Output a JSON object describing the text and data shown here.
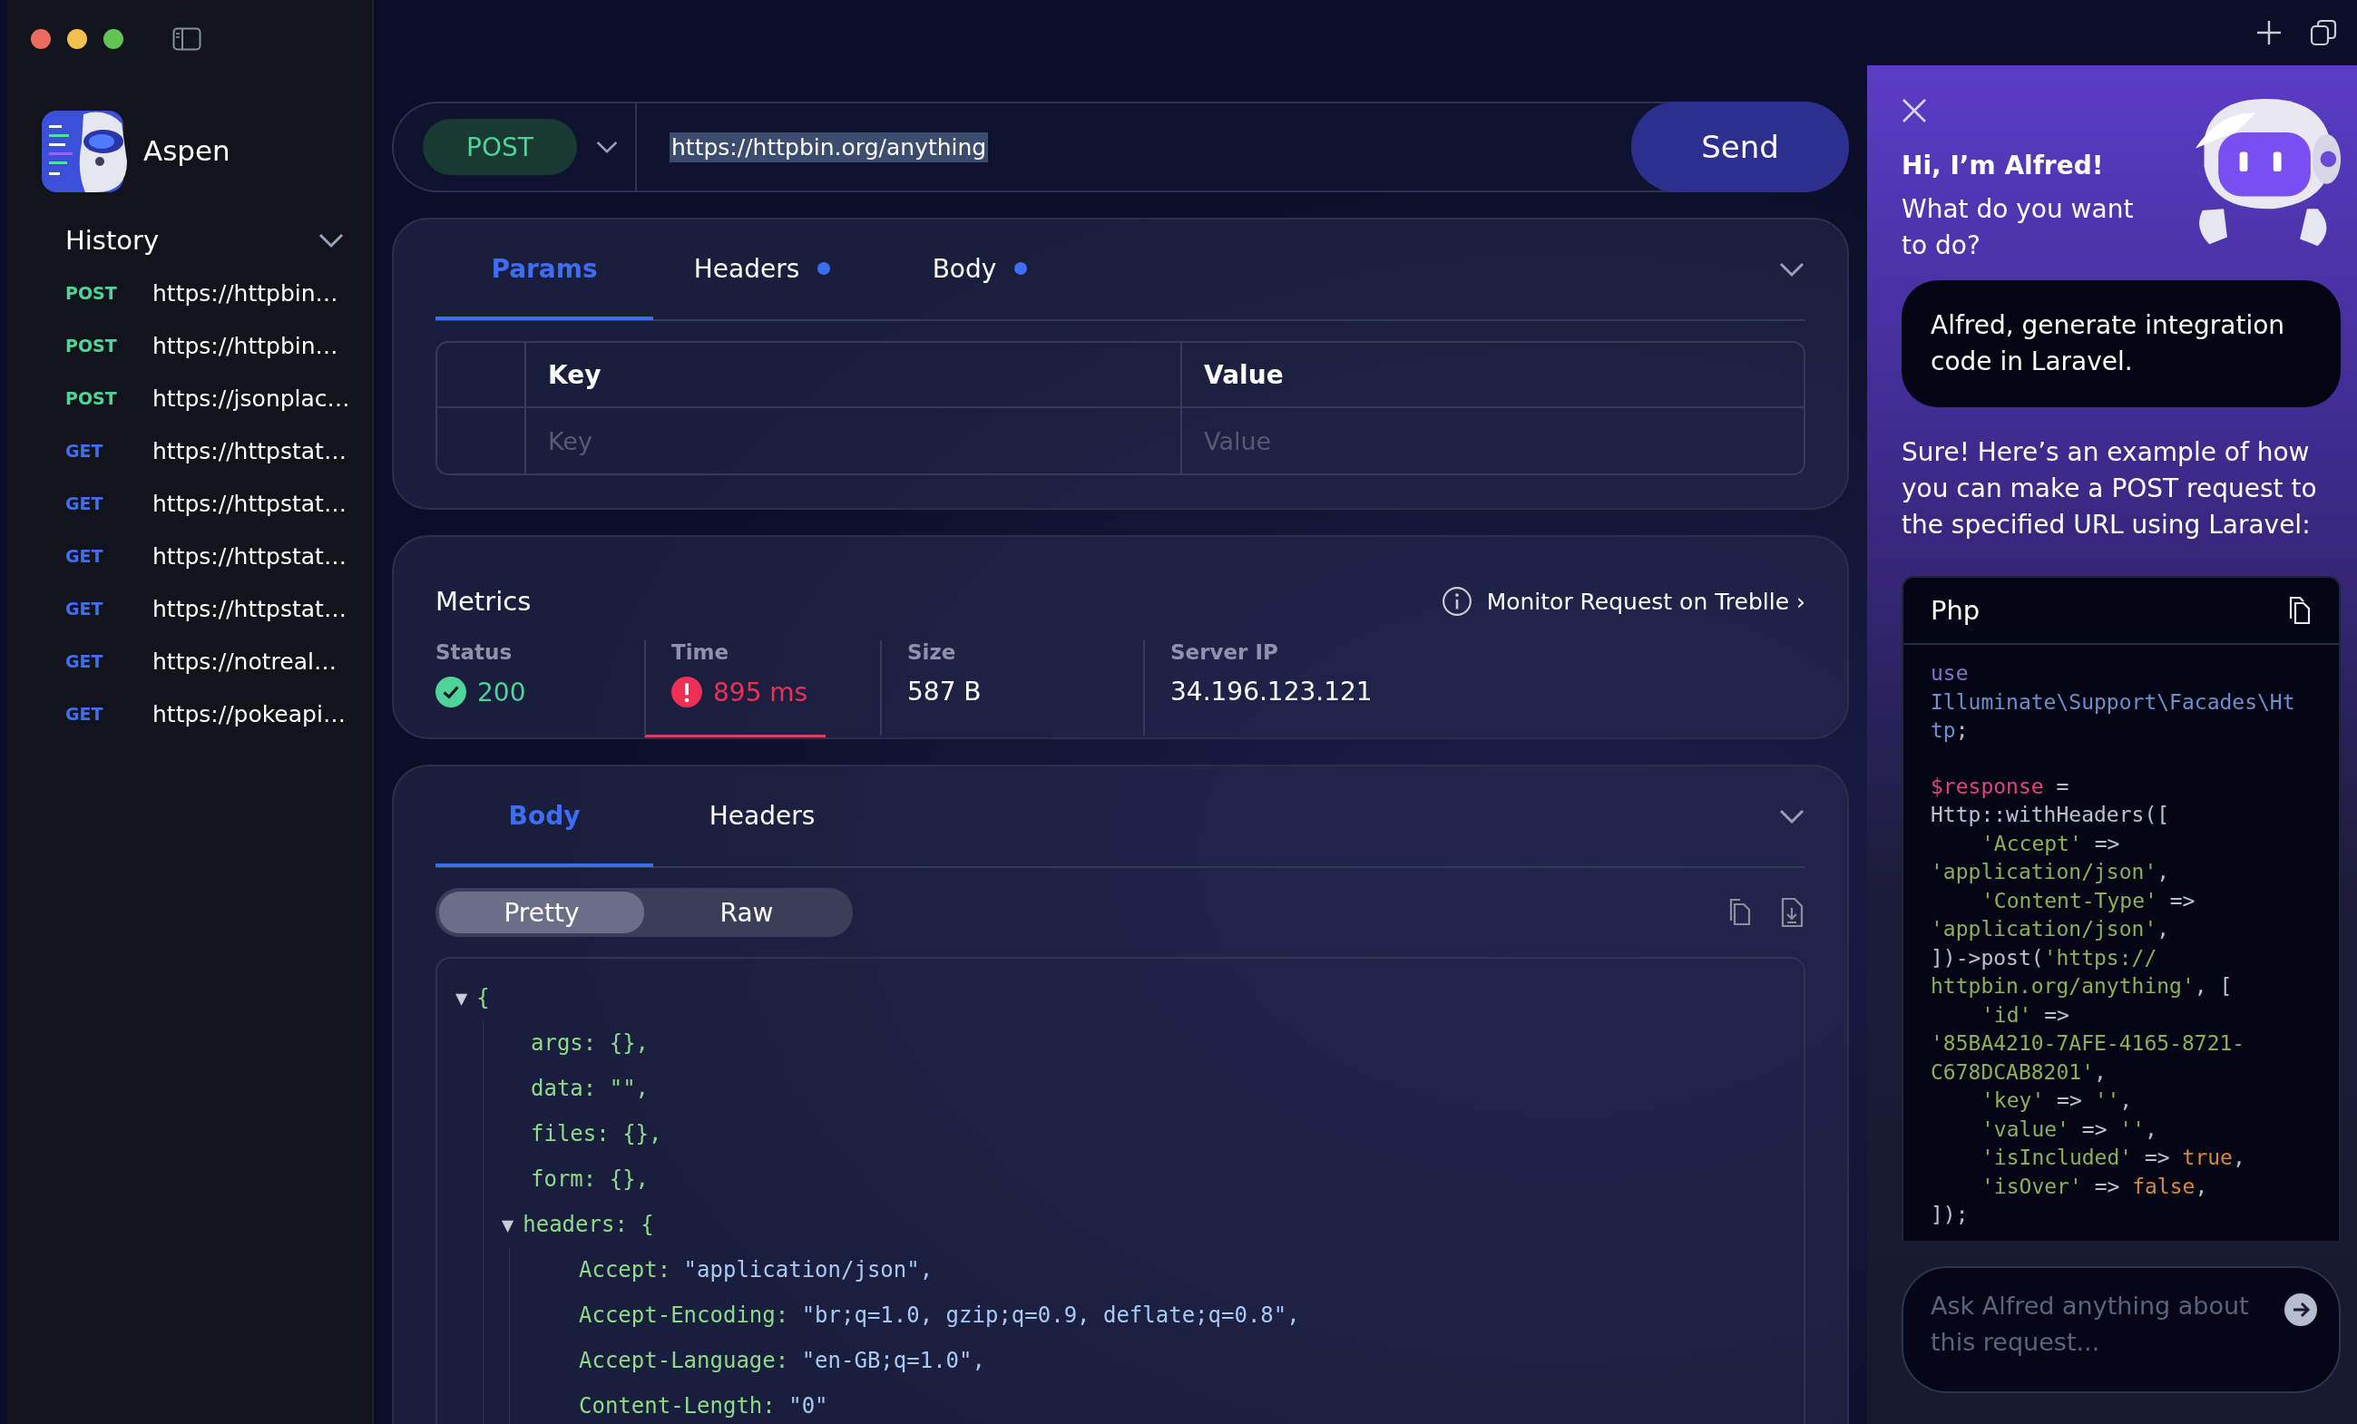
{
  "sidebar": {
    "app_name": "Aspen",
    "section": {
      "title": "History",
      "expanded": true
    },
    "history": [
      {
        "method": "POST",
        "url": "https://httpbin…"
      },
      {
        "method": "POST",
        "url": "https://httpbin…"
      },
      {
        "method": "POST",
        "url": "https://jsonplac…"
      },
      {
        "method": "GET",
        "url": "https://httpstat…"
      },
      {
        "method": "GET",
        "url": "https://httpstat…"
      },
      {
        "method": "GET",
        "url": "https://httpstat…"
      },
      {
        "method": "GET",
        "url": "https://httpstat…"
      },
      {
        "method": "GET",
        "url": "https://notreal…"
      },
      {
        "method": "GET",
        "url": "https://pokeapi…"
      }
    ]
  },
  "request": {
    "method": "POST",
    "url": "https://httpbin.org/anything",
    "url_selected": true,
    "send": "Send"
  },
  "request_tabs": [
    {
      "label": "Params",
      "selected": true,
      "dot": false
    },
    {
      "label": "Headers",
      "selected": false,
      "dot": true
    },
    {
      "label": "Body",
      "selected": false,
      "dot": true
    }
  ],
  "params_table": {
    "columns": [
      "Key",
      "Value"
    ],
    "placeholders": [
      "Key",
      "Value"
    ]
  },
  "metrics": {
    "title": "Metrics",
    "link": "Monitor Request on Treblle ›",
    "items": [
      {
        "label": "Status",
        "value": "200",
        "kind": "ok",
        "highlighted": false
      },
      {
        "label": "Time",
        "value": "895 ms",
        "kind": "error",
        "highlighted": true
      },
      {
        "label": "Size",
        "value": "587 B",
        "kind": "plain",
        "highlighted": false
      },
      {
        "label": "Server IP",
        "value": "34.196.123.121",
        "kind": "plain",
        "highlighted": false
      }
    ]
  },
  "response_tabs": [
    {
      "label": "Body",
      "selected": true
    },
    {
      "label": "Headers",
      "selected": false
    }
  ],
  "view_modes": [
    {
      "label": "Pretty",
      "selected": true
    },
    {
      "label": "Raw",
      "selected": false
    }
  ],
  "response_body": {
    "toggle": "▼",
    "open": "{",
    "expanded": true,
    "children": [
      {
        "key": "args:",
        "value": "{},",
        "kind": "plain"
      },
      {
        "key": "data:",
        "value": "\"\",",
        "kind": "plain"
      },
      {
        "key": "files:",
        "value": "{},",
        "kind": "plain"
      },
      {
        "key": "form:",
        "value": "{},",
        "kind": "plain"
      },
      {
        "key": "headers:",
        "toggle": "▼",
        "value": "{",
        "kind": "plain",
        "expanded": true,
        "children": [
          {
            "key": "Accept:",
            "value": "\"application/json\",",
            "kind": "string"
          },
          {
            "key": "Accept-Encoding:",
            "value": "\"br;q=1.0, gzip;q=0.9, deflate;q=0.8\",",
            "kind": "string"
          },
          {
            "key": "Accept-Language:",
            "value": "\"en-GB;q=1.0\",",
            "kind": "string"
          },
          {
            "key": "Content-Length:",
            "value": "\"0\"",
            "kind": "string"
          }
        ]
      }
    ]
  },
  "assistant": {
    "greeting": "Hi, I’m Alfred!",
    "question": "What do you want to do?",
    "user_message": "Alfred, generate integration code in Laravel.",
    "reply": "Sure! Here’s an example of how you can make a POST request to the specified URL using Laravel:",
    "code": {
      "language": "Php",
      "statements": [
        [
          {
            "indent": false,
            "parts": [
              {
                "t": "use",
                "kind": "keyword"
              }
            ]
          },
          {
            "indent": false,
            "parts": [
              {
                "t": "Illuminate\\Support\\Facades\\Ht",
                "kind": "namespace"
              }
            ]
          },
          {
            "indent": false,
            "parts": [
              {
                "t": "tp",
                "kind": "namespace"
              },
              {
                "t": ";",
                "kind": "plain"
              }
            ]
          }
        ],
        [
          {
            "indent": false,
            "parts": [
              {
                "t": "$response",
                "kind": "variable"
              },
              {
                "t": " =",
                "kind": "plain"
              }
            ]
          },
          {
            "indent": false,
            "parts": [
              {
                "t": "Http::withHeaders([",
                "kind": "plain"
              }
            ]
          },
          {
            "indent": true,
            "parts": [
              {
                "t": "'Accept'",
                "kind": "string"
              },
              {
                "t": " =>",
                "kind": "plain"
              }
            ]
          },
          {
            "indent": false,
            "parts": [
              {
                "t": "'application/json'",
                "kind": "string"
              },
              {
                "t": ",",
                "kind": "plain"
              }
            ]
          },
          {
            "indent": true,
            "parts": [
              {
                "t": "'Content-Type'",
                "kind": "string"
              },
              {
                "t": " =>",
                "kind": "plain"
              }
            ]
          },
          {
            "indent": false,
            "parts": [
              {
                "t": "'application/json'",
                "kind": "string"
              },
              {
                "t": ",",
                "kind": "plain"
              }
            ]
          },
          {
            "indent": false,
            "parts": [
              {
                "t": "])->post(",
                "kind": "plain"
              },
              {
                "t": "'https://",
                "kind": "string"
              }
            ]
          },
          {
            "indent": false,
            "parts": [
              {
                "t": "httpbin.org/anything'",
                "kind": "string"
              },
              {
                "t": ", [",
                "kind": "plain"
              }
            ]
          },
          {
            "indent": true,
            "parts": [
              {
                "t": "'id'",
                "kind": "string"
              },
              {
                "t": " =>",
                "kind": "plain"
              }
            ]
          },
          {
            "indent": false,
            "parts": [
              {
                "t": "'85BA4210-7AFE-4165-8721-",
                "kind": "string"
              }
            ]
          },
          {
            "indent": false,
            "parts": [
              {
                "t": "C678DCAB8201'",
                "kind": "string"
              },
              {
                "t": ",",
                "kind": "plain"
              }
            ]
          },
          {
            "indent": true,
            "parts": [
              {
                "t": "'key'",
                "kind": "string"
              },
              {
                "t": " =>",
                "kind": "plain"
              },
              {
                "t": " ''",
                "kind": "string"
              },
              {
                "t": ",",
                "kind": "plain"
              }
            ]
          },
          {
            "indent": true,
            "parts": [
              {
                "t": "'value'",
                "kind": "string"
              },
              {
                "t": " =>",
                "kind": "plain"
              },
              {
                "t": " ''",
                "kind": "string"
              },
              {
                "t": ",",
                "kind": "plain"
              }
            ]
          },
          {
            "indent": true,
            "parts": [
              {
                "t": "'isIncluded'",
                "kind": "string"
              },
              {
                "t": " =>",
                "kind": "plain"
              },
              {
                "t": " true",
                "kind": "boolean"
              },
              {
                "t": ",",
                "kind": "plain"
              }
            ]
          },
          {
            "indent": true,
            "parts": [
              {
                "t": "'isOver'",
                "kind": "string"
              },
              {
                "t": " =>",
                "kind": "plain"
              },
              {
                "t": " false",
                "kind": "boolean"
              },
              {
                "t": ",",
                "kind": "plain"
              }
            ]
          },
          {
            "indent": false,
            "parts": [
              {
                "t": "]);",
                "kind": "plain"
              }
            ]
          }
        ]
      ]
    },
    "input_placeholder": "Ask Alfred anything about this request..."
  }
}
